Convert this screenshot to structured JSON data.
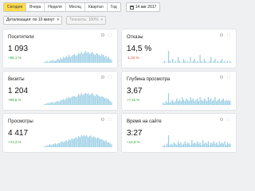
{
  "periods": [
    "Сегодня",
    "Вчера",
    "Неделя",
    "Месяц",
    "Квартал",
    "Год"
  ],
  "active_period": 0,
  "date_label": "14 авг 2017",
  "detail_label": "Детализация: по 10 минут",
  "accuracy_label": "Точность: 100%",
  "cards": [
    {
      "title": "Посетители",
      "value": "1 093",
      "delta": "+56,1 %",
      "trend": "up",
      "series": [
        1,
        1,
        2,
        1,
        2,
        2,
        3,
        2,
        2,
        3,
        4,
        3,
        5,
        4,
        6,
        5,
        7,
        6,
        8,
        6,
        7,
        8,
        9,
        7,
        8,
        10,
        9,
        11,
        9,
        10,
        12,
        10,
        11,
        9,
        10,
        11,
        9,
        8,
        10,
        9,
        8,
        7,
        9,
        8,
        6,
        7,
        5,
        6,
        4,
        3
      ]
    },
    {
      "title": "Отказы",
      "value": "14,5 %",
      "delta": "-1,22 %",
      "trend": "down",
      "series": [
        0,
        1,
        0,
        0,
        6,
        1,
        0,
        2,
        0,
        1,
        0,
        3,
        1,
        0,
        0,
        2,
        1,
        0,
        1,
        0,
        3,
        0,
        1,
        2,
        0,
        1,
        0,
        4,
        1,
        0,
        2,
        1,
        0,
        0,
        1,
        3,
        0,
        1,
        2,
        0,
        1,
        0,
        1,
        2,
        0,
        1,
        0,
        1,
        0,
        1
      ]
    },
    {
      "title": "Визиты",
      "value": "1 204",
      "delta": "+59,5 %",
      "trend": "up",
      "series": [
        1,
        1,
        2,
        2,
        2,
        3,
        3,
        2,
        3,
        4,
        4,
        3,
        5,
        5,
        6,
        5,
        7,
        7,
        8,
        7,
        8,
        9,
        9,
        8,
        9,
        11,
        10,
        12,
        10,
        11,
        12,
        11,
        12,
        10,
        11,
        12,
        10,
        9,
        11,
        10,
        9,
        8,
        9,
        8,
        7,
        7,
        6,
        6,
        4,
        3
      ]
    },
    {
      "title": "Глубина просмотра",
      "value": "3,67",
      "delta": "+7,11 %",
      "trend": "up",
      "series": [
        2,
        1,
        3,
        2,
        9,
        2,
        3,
        4,
        2,
        3,
        5,
        3,
        4,
        3,
        6,
        4,
        3,
        5,
        4,
        3,
        6,
        4,
        5,
        3,
        4,
        5,
        3,
        6,
        4,
        3,
        5,
        4,
        3,
        6,
        4,
        5,
        3,
        4,
        6,
        3,
        4,
        5,
        3,
        4,
        5,
        3,
        4,
        3,
        4,
        3
      ]
    },
    {
      "title": "Просмотры",
      "value": "4 417",
      "delta": "+71,3 %",
      "trend": "up",
      "series": [
        1,
        1,
        2,
        2,
        3,
        2,
        3,
        3,
        4,
        3,
        4,
        4,
        5,
        6,
        5,
        6,
        7,
        6,
        8,
        7,
        9,
        8,
        9,
        10,
        9,
        11,
        10,
        12,
        11,
        12,
        11,
        12,
        10,
        11,
        12,
        10,
        11,
        10,
        9,
        10,
        9,
        8,
        8,
        7,
        6,
        7,
        5,
        5,
        4,
        3
      ]
    },
    {
      "title": "Время на сайте",
      "value": "3:27",
      "delta": "+12,6 %",
      "trend": "up",
      "series": [
        1,
        2,
        1,
        3,
        10,
        2,
        3,
        2,
        4,
        3,
        2,
        5,
        3,
        4,
        2,
        3,
        5,
        3,
        4,
        3,
        2,
        6,
        3,
        4,
        3,
        5,
        3,
        4,
        2,
        6,
        3,
        4,
        3,
        5,
        2,
        4,
        3,
        5,
        3,
        4,
        2,
        5,
        3,
        4,
        3,
        5,
        2,
        4,
        3,
        3
      ]
    }
  ],
  "colors": {
    "bar": "#9ccfe6",
    "up": "#2aa02a",
    "down": "#d33c2b",
    "active": "#ffdb4d"
  },
  "icons": {
    "settings": "gear-icon",
    "drag": "grid-icon"
  }
}
